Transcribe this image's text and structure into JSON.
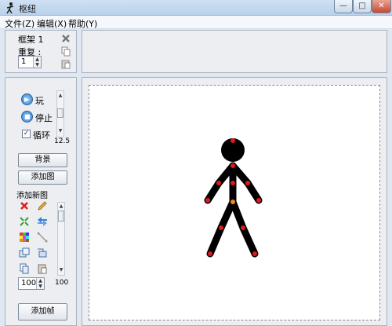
{
  "window": {
    "title": "枢纽",
    "min": "—",
    "max": "□",
    "close": "✕"
  },
  "menu": [
    "文件(Z)",
    "编辑(X)",
    "帮助(Y)"
  ],
  "frame": {
    "label": "框架 1",
    "repeat_label": "重复 :",
    "repeat_value": "1"
  },
  "playback": {
    "play": "玩",
    "stop": "停止",
    "loop": "循环",
    "loop_checked": "✓",
    "speed": "12.5"
  },
  "buttons": {
    "background": "背景",
    "add_image": "添加图",
    "add_frame": "添加帧"
  },
  "figures": {
    "title": "添加新图",
    "size_value": "100",
    "size_right": "100"
  },
  "icons": {
    "delete_frame": "delete-x-icon",
    "copy_frame": "copy-icon",
    "paste_frame": "paste-icon",
    "tools": [
      "delete-red-x-icon",
      "pencil-icon",
      "scale-arrows-icon",
      "flip-arrows-icon",
      "color-grid-icon",
      "line-segment-icon",
      "duplicate-figure-icon",
      "layer-icon",
      "copy-figure-icon",
      "paste-figure-icon"
    ]
  },
  "colors": {
    "joint": "#e0191d",
    "root_joint": "#f08a1b",
    "figure": "#000000"
  }
}
